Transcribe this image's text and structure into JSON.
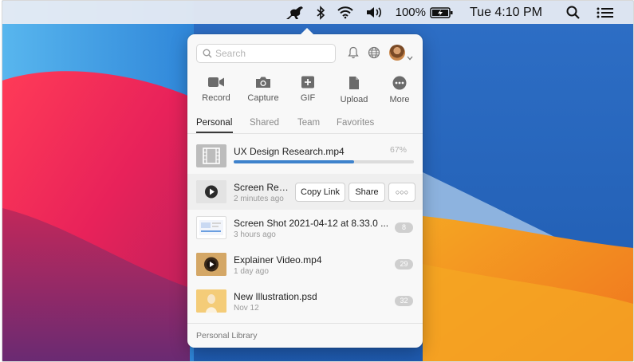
{
  "menubar": {
    "battery_percent": "100%",
    "clock": "Tue 4:10 PM",
    "icons": [
      "kangaroo-app-icon",
      "bluetooth-icon",
      "wifi-icon",
      "volume-icon",
      "battery-charging-icon",
      "spotlight-search-icon",
      "control-center-icon"
    ]
  },
  "popup": {
    "search": {
      "placeholder": "Search",
      "value": ""
    },
    "header_icons": [
      "bell-icon",
      "globe-icon",
      "avatar",
      "chevron-down-icon"
    ],
    "actions": [
      {
        "label": "Record",
        "icon": "video-camera-icon"
      },
      {
        "label": "Capture",
        "icon": "camera-icon"
      },
      {
        "label": "GIF",
        "icon": "gif-plus-icon"
      },
      {
        "label": "Upload",
        "icon": "document-icon"
      },
      {
        "label": "More",
        "icon": "more-dots-icon"
      }
    ],
    "tabs": [
      {
        "label": "Personal",
        "active": true
      },
      {
        "label": "Shared",
        "active": false
      },
      {
        "label": "Team",
        "active": false
      },
      {
        "label": "Favorites",
        "active": false
      }
    ],
    "uploading": {
      "name": "UX Design Research.mp4",
      "percent_label": "67%",
      "progress": 0.67
    },
    "hover_row": {
      "name": "Screen Rec...",
      "meta": "2 minutes ago",
      "copy_link": "Copy Link",
      "share": "Share",
      "more": "○○○"
    },
    "files": [
      {
        "name": "Screen Shot 2021-04-12 at 8.33.0 ...",
        "meta": "3 hours ago",
        "badge": "8"
      },
      {
        "name": "Explainer Video.mp4",
        "meta": "1 day ago",
        "badge": "29"
      },
      {
        "name": "New Illustration.psd",
        "meta": "Nov 12",
        "badge": "32"
      }
    ],
    "footer": "Personal Library"
  },
  "colors": {
    "accent": "#3e82cc",
    "popup_bg": "#f8f8f8",
    "badge": "#cfcfcf"
  }
}
